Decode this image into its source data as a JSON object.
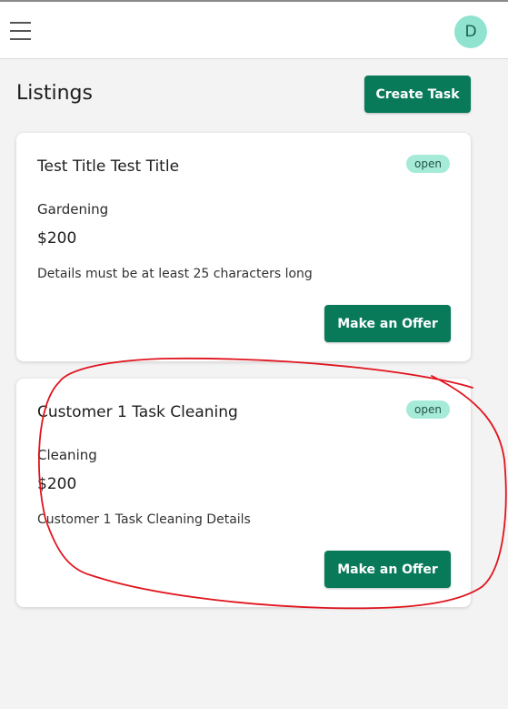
{
  "header": {
    "menu_icon": "hamburger-icon",
    "avatar_initial": "D"
  },
  "main": {
    "title": "Listings",
    "create_button_label": "Create Task",
    "listings": [
      {
        "title": "Test Title Test Title",
        "status": "open",
        "category": "Gardening",
        "price": "$200",
        "details": "Details must be at least 25 characters long",
        "offer_button_label": "Make an Offer"
      },
      {
        "title": "Customer 1 Task Cleaning",
        "status": "open",
        "category": "Cleaning",
        "price": "$200",
        "details": "Customer 1 Task Cleaning Details",
        "offer_button_label": "Make an Offer"
      }
    ]
  },
  "colors": {
    "accent": "#087a5a",
    "badge_bg": "#a6ebd7",
    "avatar_bg": "#8fe3cf",
    "annotation": "#e0141e"
  }
}
